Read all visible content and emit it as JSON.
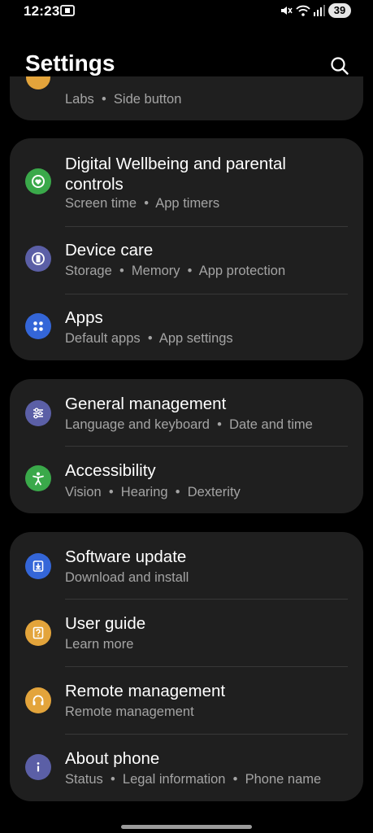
{
  "status_bar": {
    "time": "12:23",
    "battery": "39",
    "icons": [
      "screen-record-icon",
      "mute-icon",
      "wifi-icon",
      "signal-icon",
      "battery-icon"
    ]
  },
  "header": {
    "title": "Settings",
    "search_icon": "search-icon"
  },
  "colors": {
    "background": "#000000",
    "card": "#1f1f1f",
    "subtitle": "#a4a4a4",
    "green": "#3aa94a",
    "purple": "#5b5fa6",
    "blue": "#3466d8",
    "yellow": "#e3a43b"
  },
  "top_card": {
    "subtitle": [
      "Labs",
      "Side button"
    ]
  },
  "groups": [
    {
      "items": [
        {
          "title": "Digital Wellbeing and parental controls",
          "subtitle": [
            "Screen time",
            "App timers"
          ],
          "icon": "wellbeing-icon"
        },
        {
          "title": "Device care",
          "subtitle": [
            "Storage",
            "Memory",
            "App protection"
          ],
          "icon": "device-care-icon"
        },
        {
          "title": "Apps",
          "subtitle": [
            "Default apps",
            "App settings"
          ],
          "icon": "apps-icon"
        }
      ]
    },
    {
      "items": [
        {
          "title": "General management",
          "subtitle": [
            "Language and keyboard",
            "Date and time"
          ],
          "icon": "sliders-icon"
        },
        {
          "title": "Accessibility",
          "subtitle": [
            "Vision",
            "Hearing",
            "Dexterity"
          ],
          "icon": "accessibility-icon"
        }
      ]
    },
    {
      "items": [
        {
          "title": "Software update",
          "subtitle": [
            "Download and install"
          ],
          "icon": "software-update-icon"
        },
        {
          "title": "User guide",
          "subtitle": [
            "Learn more"
          ],
          "icon": "user-guide-icon"
        },
        {
          "title": "Remote management",
          "subtitle": [
            "Remote management"
          ],
          "icon": "headset-icon"
        },
        {
          "title": "About phone",
          "subtitle": [
            "Status",
            "Legal information",
            "Phone name"
          ],
          "icon": "info-icon"
        }
      ]
    }
  ]
}
